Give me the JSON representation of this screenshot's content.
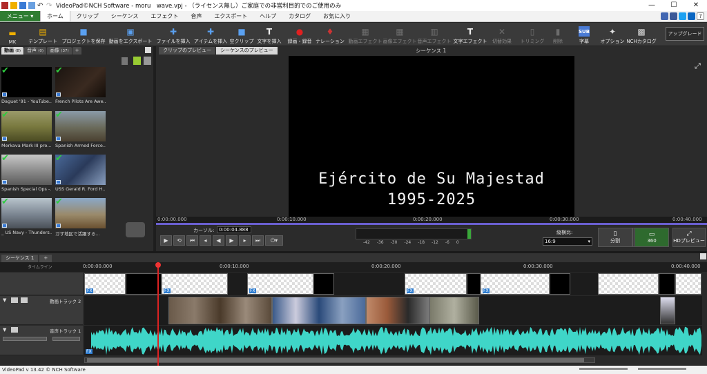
{
  "window": {
    "title": "VideoPad©NCH Software - moru　wave.vpj - （ライセンス無し）ご家庭での非営利目的でのご使用のみ",
    "min": "—",
    "max": "☐",
    "close": "✕"
  },
  "menubar": {
    "menu_button": "メニュー ▾",
    "tabs": [
      "ホーム",
      "クリップ",
      "シーケンス",
      "エフェクト",
      "音声",
      "エクスポート",
      "ヘルプ",
      "カタログ",
      "お気に入り"
    ]
  },
  "toolbar": {
    "buttons": [
      {
        "label": "MK",
        "icon": "folder-icon"
      },
      {
        "label": "テンプレート",
        "icon": "template-icon"
      },
      {
        "label": "プロジェクトを保存",
        "icon": "save-icon"
      },
      {
        "label": "動画をエクスポート",
        "icon": "export-icon"
      },
      {
        "label": "ファイルを挿入",
        "icon": "add-file-icon"
      },
      {
        "label": "アイテムを挿入",
        "icon": "add-item-icon"
      },
      {
        "label": "空クリップ",
        "icon": "blank-clip-icon"
      },
      {
        "label": "文字を挿入",
        "icon": "text-icon"
      },
      {
        "label": "録画・録音",
        "icon": "record-icon"
      },
      {
        "label": "ナレーション",
        "icon": "mic-icon"
      },
      {
        "label": "動画エフェクト",
        "icon": "video-effects-icon"
      },
      {
        "label": "画像エフェクト",
        "icon": "image-effects-icon"
      },
      {
        "label": "音声エフェクト",
        "icon": "audio-effects-icon"
      },
      {
        "label": "文字エフェクト",
        "icon": "text-effects-icon"
      },
      {
        "label": "切替効果",
        "icon": "transition-icon"
      },
      {
        "label": "トリミング",
        "icon": "trim-icon"
      },
      {
        "label": "削除",
        "icon": "delete-icon"
      },
      {
        "label": "字幕",
        "icon": "subtitle-icon"
      },
      {
        "label": "オプション",
        "icon": "options-icon"
      },
      {
        "label": "NCHカタログ",
        "icon": "catalog-icon"
      }
    ],
    "upgrade": "アップグレード"
  },
  "media_bin": {
    "tabs": [
      {
        "label": "動画",
        "count": "(8)"
      },
      {
        "label": "音声",
        "count": "(0)"
      },
      {
        "label": "画像",
        "count": "(37)"
      },
      {
        "label": "+",
        "count": ""
      }
    ],
    "items": [
      "Daguet '91 - YouTube...",
      "French Pilots Are Awe...",
      "Merkava Mark III pro...",
      "Spanish Armed Force...",
      "Spanish Special Ops -...",
      "USS Gerald R. Ford H...",
      "_ US Navy - Thunders...",
      "ガザ地区で活躍する..."
    ]
  },
  "preview": {
    "tabs": [
      "クリップのプレビュー",
      "シーケンスのプレビュー"
    ],
    "sequence_title": "シーケンス 1",
    "overlay_line1": "Ejército de Su Majestad",
    "overlay_line2": "1995-2025",
    "ruler_ticks": [
      "0:00:00.000",
      "0:00:10.000",
      "0:00:20.000",
      "0:00:30.000",
      "0:00:40.000"
    ],
    "cursor_label": "カーソル:",
    "cursor_value": "0:00:04.888",
    "meter_scale": [
      "-42",
      "-36",
      "-30",
      "-24",
      "-18",
      "-12",
      "-6",
      "0"
    ],
    "aspect_label": "縦横比:",
    "aspect_value": "16:9",
    "split_label": "分割",
    "vr_label": "360",
    "hd_label": "HDプレビュー"
  },
  "timeline": {
    "tabs": [
      "シーケンス 1",
      "+"
    ],
    "ruler_label": "タイムライン",
    "ticks": [
      "0:00:00.000",
      "0:00:10.000",
      "0:00:20.000",
      "0:00:30.000",
      "0:00:40.000"
    ],
    "video_track": "動画トラック 2",
    "audio_track": "音声トラック 1",
    "fx": "FX"
  },
  "status": {
    "version": "VideoPad v 13.42 © NCH Software"
  },
  "colors": {
    "accent_green": "#2f7d32",
    "waveform": "#3fd6c8",
    "playhead": "#dd2222",
    "ruler_bar": "#6a5fd0"
  }
}
